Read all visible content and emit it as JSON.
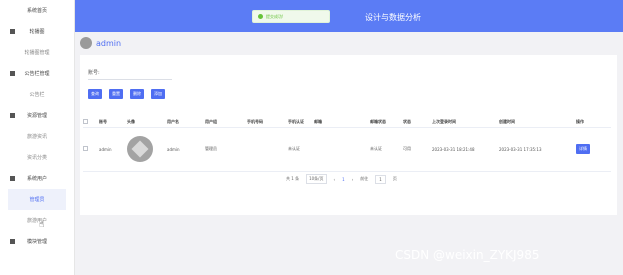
{
  "header": {
    "title": "设计与数据分析"
  },
  "toast": {
    "message": "提交成功!"
  },
  "sidebar": {
    "items": [
      {
        "label": "系统首页",
        "type": "top"
      },
      {
        "label": "轮播图",
        "type": "group"
      },
      {
        "label": "轮播图管理",
        "type": "sub"
      },
      {
        "label": "公告栏管理",
        "type": "group"
      },
      {
        "label": "公告栏",
        "type": "sub"
      },
      {
        "label": "资源管理",
        "type": "group"
      },
      {
        "label": "旅游资讯",
        "type": "sub"
      },
      {
        "label": "资讯分类",
        "type": "sub"
      },
      {
        "label": "系统用户",
        "type": "group"
      },
      {
        "label": "管理员",
        "type": "sub-active"
      },
      {
        "label": "旅游用户",
        "type": "sub"
      },
      {
        "label": "模块管理",
        "type": "group"
      }
    ]
  },
  "userbar": {
    "name": "admin"
  },
  "search": {
    "label": "账号:"
  },
  "toolbar": {
    "query": "查询",
    "reset": "重置",
    "delete": "删除",
    "add": "添加"
  },
  "table": {
    "columns": [
      "账号",
      "头像",
      "用户名",
      "用户组",
      "手机号码",
      "手机认证",
      "邮箱",
      "邮箱状态",
      "状态",
      "上次登录时间",
      "创建时间",
      "操作"
    ],
    "rows": [
      {
        "account": "admin",
        "username": "admin",
        "group": "管理员",
        "phone": "",
        "phone_auth": "未认证",
        "email": "",
        "email_status": "未认证",
        "status": "可用",
        "last_login": "2023-03-31 18:21:48",
        "created": "2023-03-31 17:35:13",
        "action": "详情"
      }
    ]
  },
  "pager": {
    "total": "共 1 条",
    "page_size": "10条/页",
    "prev": "‹",
    "current": "1",
    "next": "›",
    "goto": "前往",
    "goto_page": "1",
    "unit": "页"
  },
  "watermark": "CSDN @weixin_ZYKJ985"
}
